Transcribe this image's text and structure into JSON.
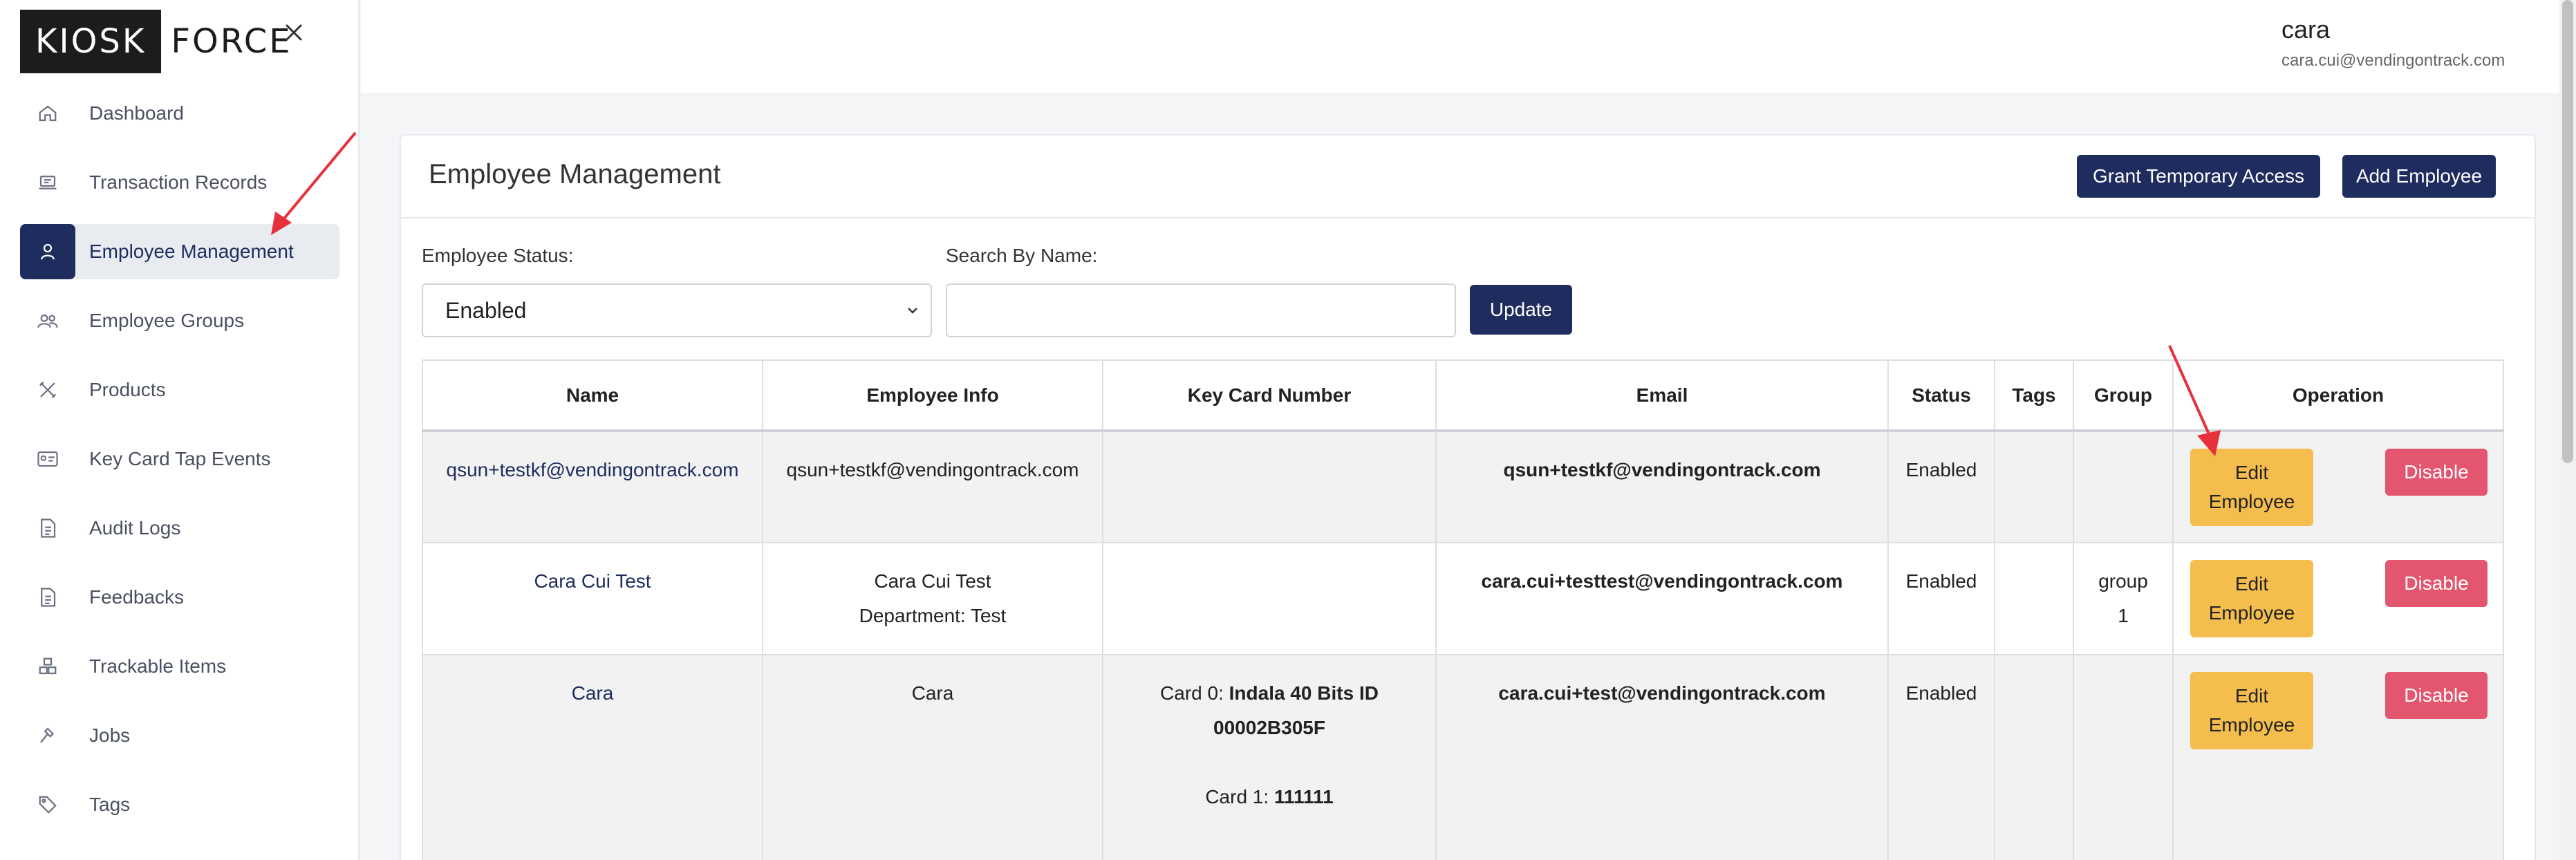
{
  "logo": {
    "part1": "KIOSK",
    "part2": "FORCE"
  },
  "sidebar": {
    "items": [
      {
        "label": "Dashboard",
        "icon": "home-icon"
      },
      {
        "label": "Transaction Records",
        "icon": "receipt-icon"
      },
      {
        "label": "Employee Management",
        "icon": "user-icon",
        "active": true
      },
      {
        "label": "Employee Groups",
        "icon": "users-icon"
      },
      {
        "label": "Products",
        "icon": "tools-icon"
      },
      {
        "label": "Key Card Tap Events",
        "icon": "id-card-icon"
      },
      {
        "label": "Audit Logs",
        "icon": "document-icon"
      },
      {
        "label": "Feedbacks",
        "icon": "document-icon"
      },
      {
        "label": "Trackable Items",
        "icon": "boxes-icon"
      },
      {
        "label": "Jobs",
        "icon": "hammer-icon"
      },
      {
        "label": "Tags",
        "icon": "tag-icon"
      }
    ]
  },
  "user": {
    "name": "cara",
    "email": "cara.cui@vendingontrack.com"
  },
  "page": {
    "title": "Employee Management",
    "grant_button": "Grant Temporary Access",
    "add_button": "Add Employee"
  },
  "filters": {
    "status_label": "Employee Status:",
    "status_value": "Enabled",
    "search_label": "Search By Name:",
    "search_value": "",
    "update_button": "Update"
  },
  "table": {
    "headers": [
      "Name",
      "Employee Info",
      "Key Card Number",
      "Email",
      "Status",
      "Tags",
      "Group",
      "Operation"
    ],
    "rows": [
      {
        "name": "qsun+testkf@vendingontrack.com",
        "info": [
          "qsun+testkf@vendingontrack.com"
        ],
        "cards": [],
        "email": "qsun+testkf@vendingontrack.com",
        "status": "Enabled",
        "tags": "",
        "group": [
          "",
          ""
        ]
      },
      {
        "name": "Cara Cui Test",
        "info": [
          "Cara Cui Test",
          "Department: Test"
        ],
        "cards": [],
        "email": "cara.cui+testtest@vendingontrack.com",
        "status": "Enabled",
        "tags": "",
        "group": [
          "group",
          "1"
        ]
      },
      {
        "name": "Cara",
        "info": [
          "Cara"
        ],
        "cards": [
          {
            "prefix": "Card 0: ",
            "value_line1": "Indala 40 Bits ID",
            "value_line2": "00002B305F"
          },
          {
            "prefix": "Card 1: ",
            "value_line1": "111111",
            "value_line2": ""
          }
        ],
        "email": "cara.cui+test@vendingontrack.com",
        "status": "Enabled",
        "tags": "",
        "group": [
          "",
          ""
        ]
      }
    ],
    "edit_button": [
      "Edit",
      "Employee"
    ],
    "disable_button": "Disable"
  },
  "colors": {
    "navy": "#1e2d5e",
    "edit_yellow": "#f4bd4d",
    "disable_red": "#e4566f",
    "annotation_arrow": "#e8303a"
  }
}
